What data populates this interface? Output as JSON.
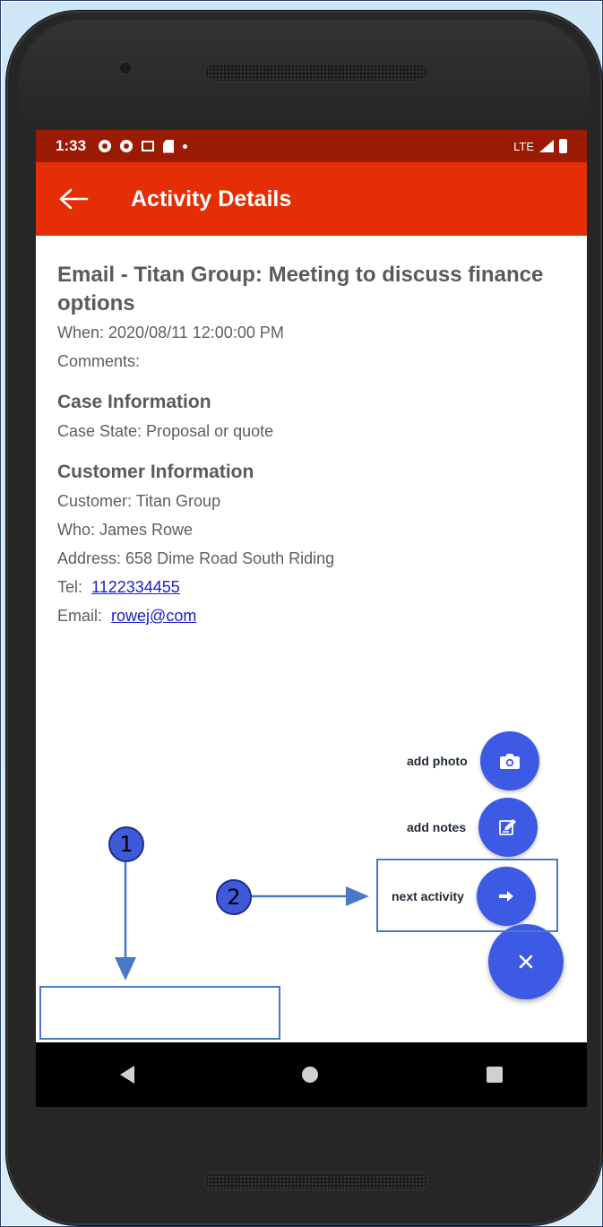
{
  "status_bar": {
    "time": "1:33",
    "network": "LTE",
    "icons": [
      "gear-icon",
      "gear-icon",
      "calendar-icon",
      "sd-card-icon",
      "dot-icon",
      "signal-icon",
      "battery-icon"
    ]
  },
  "app_bar": {
    "title": "Activity Details",
    "back_icon": "arrow-left-icon"
  },
  "activity": {
    "title": "Email - Titan Group: Meeting to discuss finance options",
    "when": "When: 2020/08/11 12:00:00 PM",
    "comments": "Comments:"
  },
  "case_info": {
    "heading": "Case Information",
    "state": "Case State: Proposal or quote"
  },
  "customer_info": {
    "heading": "Customer Information",
    "customer": "Customer: Titan Group",
    "who": "Who: James Rowe",
    "address": "Address: 658 Dime Road South Riding",
    "tel_label": "Tel:",
    "tel_value": "1122334455",
    "email_label": "Email:",
    "email_value": "rowej@com"
  },
  "fab_menu": {
    "items": [
      {
        "label": "add photo",
        "icon": "camera-icon"
      },
      {
        "label": "add notes",
        "icon": "edit-note-icon"
      },
      {
        "label": "next activity",
        "icon": "arrow-right-icon"
      }
    ],
    "main_icon": "close-icon"
  },
  "nav_bar": {
    "icons": [
      "nav-back-icon",
      "nav-home-icon",
      "nav-recent-icon"
    ]
  },
  "annotations": {
    "callout_1": "1",
    "callout_2": "2"
  },
  "colors": {
    "status_bar": "#9a1a04",
    "app_bar": "#e52e06",
    "fab": "#3d5ae4",
    "link": "#1a21c9",
    "annotation": "#4a78c9"
  }
}
